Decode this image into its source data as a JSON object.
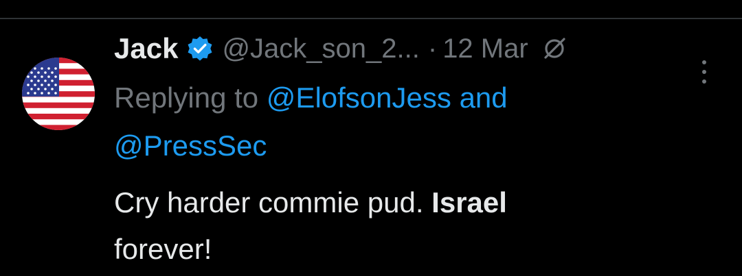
{
  "tweet": {
    "display_name": "Jack",
    "handle": "@Jack_son_2...",
    "separator": "·",
    "timestamp": "12 Mar",
    "reply_prefix": "Replying to",
    "mention_1": "@ElofsonJess",
    "reply_and": "and",
    "mention_2": "@PressSec",
    "text_plain": "Cry harder commie pud.",
    "text_bold": "Israel",
    "text_end": "forever!"
  },
  "icons": {
    "verified": "verified-badge-icon",
    "grok": "grok-icon",
    "more": "more-vertical-icon",
    "avatar": "us-flag-avatar"
  },
  "colors": {
    "background": "#000000",
    "primary_text": "#e7e9ea",
    "secondary_text": "#71767b",
    "accent": "#1d9bf0",
    "divider": "#2f3336"
  }
}
